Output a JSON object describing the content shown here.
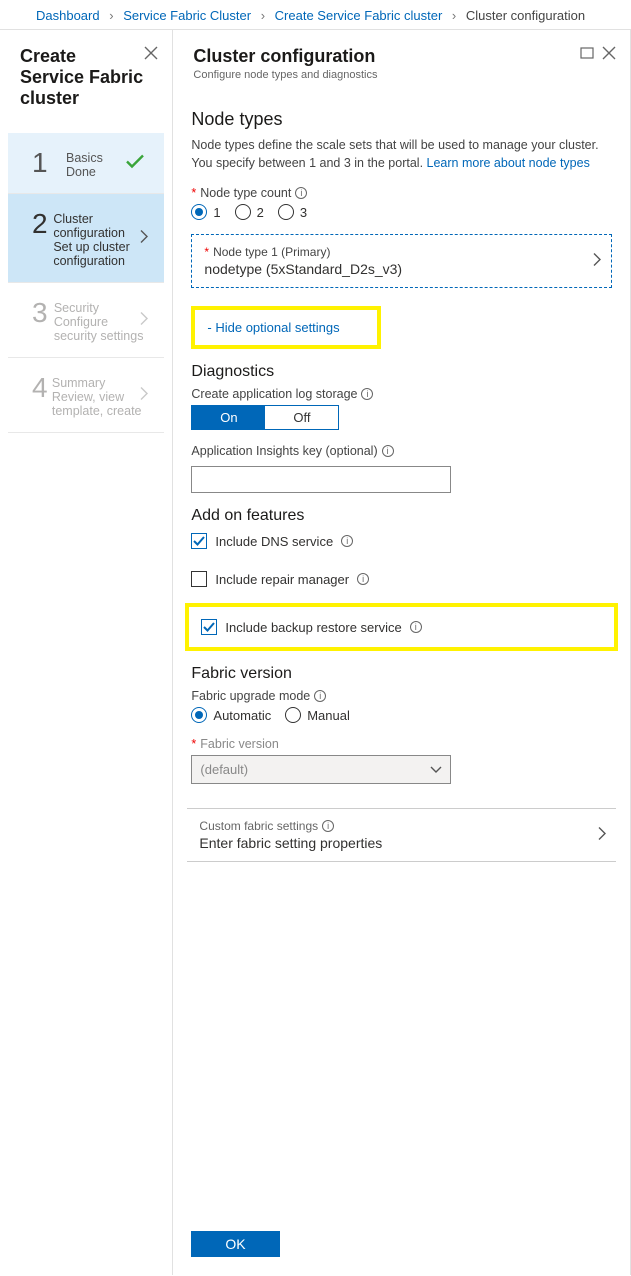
{
  "breadcrumb": {
    "items": [
      {
        "label": "Dashboard",
        "link": true
      },
      {
        "label": "Service Fabric Cluster",
        "link": true
      },
      {
        "label": "Create Service Fabric cluster",
        "link": true
      },
      {
        "label": "Cluster configuration",
        "link": false
      }
    ]
  },
  "left": {
    "title": "Create Service Fabric cluster",
    "steps": [
      {
        "num": "1",
        "title": "Basics",
        "sub": "Done",
        "state": "done"
      },
      {
        "num": "2",
        "title": "Cluster configuration",
        "sub": "Set up cluster configuration",
        "state": "current"
      },
      {
        "num": "3",
        "title": "Security",
        "sub": "Configure security settings",
        "state": "future"
      },
      {
        "num": "4",
        "title": "Summary",
        "sub": "Review, view template, create",
        "state": "future"
      }
    ]
  },
  "right": {
    "title": "Cluster configuration",
    "subtitle": "Configure node types and diagnostics",
    "node_types": {
      "heading": "Node types",
      "desc": "Node types define the scale sets that will be used to manage your cluster. You specify between 1 and 3 in the portal. ",
      "learn_more": "Learn more about node types",
      "count_label": "Node type count",
      "count_options": [
        "1",
        "2",
        "3"
      ],
      "count_selected": "1",
      "primary_label": "Node type 1 (Primary)",
      "primary_value": "nodetype (5xStandard_D2s_v3)"
    },
    "toggle_link": "- Hide optional settings",
    "diagnostics": {
      "heading": "Diagnostics",
      "storage_label": "Create application log storage",
      "on": "On",
      "off": "Off",
      "appinsights_label": "Application Insights key (optional)",
      "appinsights_value": ""
    },
    "addons": {
      "heading": "Add on features",
      "dns": "Include DNS service",
      "repair": "Include repair manager",
      "backup": "Include backup restore service"
    },
    "fabric": {
      "heading": "Fabric version",
      "mode_label": "Fabric upgrade mode",
      "mode_options": [
        "Automatic",
        "Manual"
      ],
      "mode_selected": "Automatic",
      "version_label": "Fabric version",
      "version_value": "(default)",
      "custom_label": "Custom fabric settings",
      "custom_value": "Enter fabric setting properties"
    },
    "ok": "OK"
  }
}
